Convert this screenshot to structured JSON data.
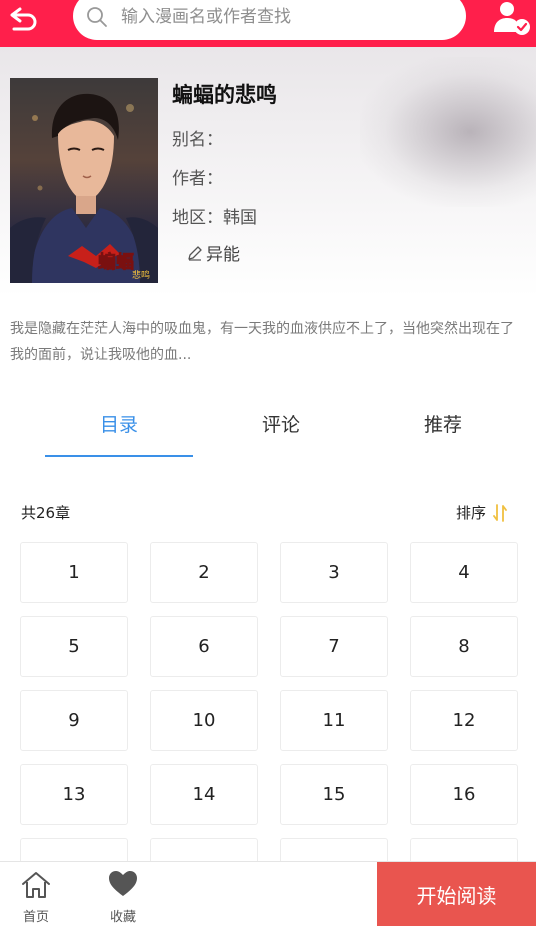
{
  "search": {
    "placeholder": "输入漫画名或作者查找"
  },
  "comic": {
    "title": "蝙蝠的悲鸣",
    "alias": "别名：",
    "author": "作者：",
    "region": "地区：韩国",
    "tag": "异能",
    "cover_logo": "蝙蝠",
    "cover_logo_sub": "悲鸣",
    "description": "我是隐藏在茫茫人海中的吸血鬼，有一天我的血液供应不上了，当他突然出现在了我的面前，说让我吸他的血..."
  },
  "tabs": [
    {
      "label": "目录",
      "active": true
    },
    {
      "label": "评论",
      "active": false
    },
    {
      "label": "推荐",
      "active": false
    }
  ],
  "chapters": {
    "count_label": "共26章",
    "sort_label": "排序",
    "items": [
      "1",
      "2",
      "3",
      "4",
      "5",
      "6",
      "7",
      "8",
      "9",
      "10",
      "11",
      "12",
      "13",
      "14",
      "15",
      "16"
    ]
  },
  "bottom": {
    "home_label": "首页",
    "favorite_label": "收藏",
    "start_label": "开始阅读"
  },
  "colors": {
    "brand": "#ff1f4b",
    "tab_active": "#3a90e8",
    "start_button": "#e9554f",
    "sort_icon": "#f0c040"
  },
  "icons": {
    "back": "back-arrow-icon",
    "search": "search-icon",
    "user": "user-check-icon",
    "tag": "pencil-icon",
    "sort": "sort-arrows-icon",
    "home": "home-icon",
    "favorite": "heart-icon"
  }
}
